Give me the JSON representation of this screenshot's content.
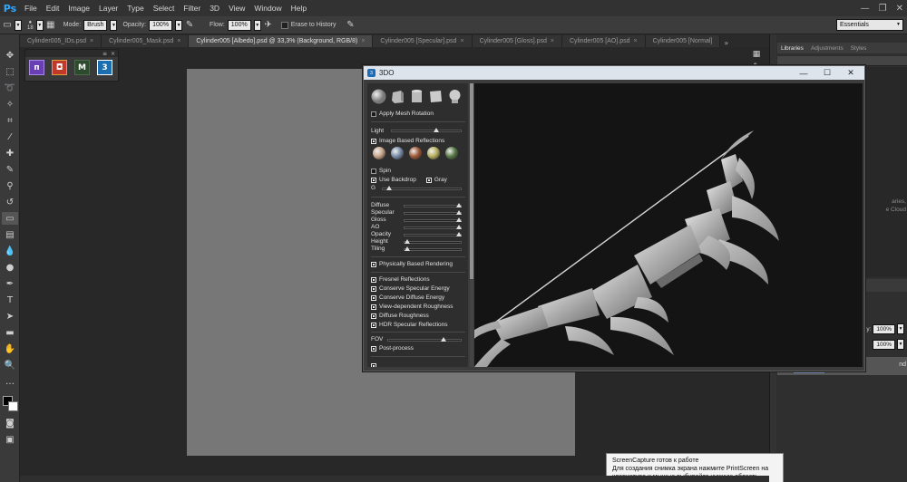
{
  "app": {
    "logo": "Ps"
  },
  "menu": [
    "File",
    "Edit",
    "Image",
    "Layer",
    "Type",
    "Select",
    "Filter",
    "3D",
    "View",
    "Window",
    "Help"
  ],
  "window_controls": [
    "—",
    "❐",
    "✕"
  ],
  "options": {
    "brush_size": "18",
    "mode_label": "Mode:",
    "mode_value": "Brush",
    "opacity_label": "Opacity:",
    "opacity_value": "100%",
    "flow_label": "Flow:",
    "flow_value": "100%",
    "erase_history_label": "Erase to History",
    "workspace": "Essentials"
  },
  "tabs": [
    {
      "label": "Cylinder005_IDs.psd",
      "active": false
    },
    {
      "label": "Cylinder005_Mask.psd",
      "active": false
    },
    {
      "label": "Cylinder005 [Albedo].psd @ 33,3% (Background, RGB/8)",
      "active": true
    },
    {
      "label": "Cylinder005 [Specular].psd",
      "active": false
    },
    {
      "label": "Cylinder005 [Gloss].psd",
      "active": false
    },
    {
      "label": "Cylinder005 [AO].psd",
      "active": false
    },
    {
      "label": "Cylinder005 [Normal]",
      "active": false
    }
  ],
  "tabs_more": "»",
  "plugin_panel": {
    "header_ctrls": [
      "≡",
      "×"
    ],
    "buttons": [
      {
        "glyph": "п",
        "color": "#6a3fb6",
        "border": "#a68ae6"
      },
      {
        "glyph": "◘",
        "color": "#c0392b",
        "border": "#e0a030"
      },
      {
        "glyph": "M",
        "color": "#2e4a2e",
        "border": "#4a6a4a"
      },
      {
        "glyph": "3",
        "color": "#1a6fb0",
        "border": "#ffffff"
      }
    ]
  },
  "dock": {
    "tabs": [
      "Libraries",
      "Adjustments",
      "Styles"
    ],
    "libraries_text": [
      "aries,",
      "e Cloud"
    ],
    "opacity_label": "ity:",
    "opacity_value": "100%",
    "fill_value": "100%",
    "layer_name": "nd"
  },
  "win3do": {
    "title": "3DO",
    "controls": [
      "—",
      "☐",
      "✕"
    ],
    "apply_mesh_rotation": "Apply Mesh Rotation",
    "light": "Light",
    "image_based_reflections": "Image Based Reflections",
    "spin": "Spin",
    "use_backdrop": "Use Backdrop",
    "gray": "Gray",
    "g": "G",
    "params": [
      "Diffuse",
      "Specular",
      "Gloss",
      "AO",
      "Opacity",
      "Height",
      "Tiling"
    ],
    "pbr": "Physically Based Rendering",
    "options": [
      "Fresnel Reflections",
      "Conserve Specular Energy",
      "Conserve Diffuse Energy",
      "View-dependent Roughness",
      "Diffuse Roughness",
      "HDR Specular Reflections"
    ],
    "fov": "FOV",
    "post_process": "Post-process",
    "sphere_colors": [
      "#c9a58a",
      "#7a8ea8",
      "#a05a3a",
      "#b8b060",
      "#5a7a4a"
    ]
  },
  "tooltip": {
    "line1": "ScreenCapture готов к работе",
    "line2": "Для создания снимка экрана нажмите PrintScreen на",
    "line3": "клавиатуре и мышью выбирайте нужную область"
  }
}
